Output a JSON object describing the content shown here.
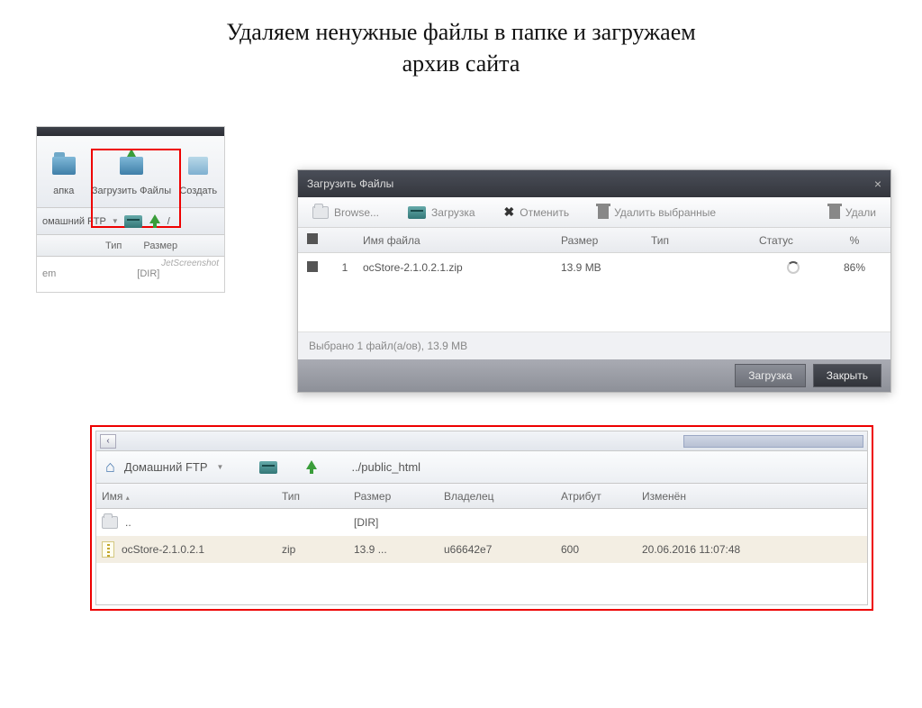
{
  "title_line1": "Удаляем ненужные файлы в папке и загружаем",
  "title_line2": "архив сайта",
  "panelA": {
    "btn_folder": "апка",
    "btn_upload": "Загрузить Файлы",
    "btn_create": "Создать",
    "path_label": "омашний FTP",
    "slash": "/",
    "head_type": "Тип",
    "head_size": "Размер",
    "watermark": "JetScreenshot",
    "dir": "[DIR]",
    "em": "em"
  },
  "panelB": {
    "dialog_title": "Загрузить Файлы",
    "browse": "Browse...",
    "upload": "Загрузка",
    "cancel": "Отменить",
    "delete_selected": "Удалить выбранные",
    "delete": "Удали",
    "col_name": "Имя файла",
    "col_size": "Размер",
    "col_type": "Тип",
    "col_status": "Статус",
    "col_pct": "%",
    "row_num": "1",
    "row_name": "ocStore-2.1.0.2.1.zip",
    "row_size": "13.9 MB",
    "row_pct": "86%",
    "footer_info": "Выбрано 1 файл(а/ов), 13.9 MB",
    "btn_upload": "Загрузка",
    "btn_close": "Закрыть"
  },
  "panelC": {
    "nav_home": "Домашний FTP",
    "nav_path": "../public_html",
    "col_name": "Имя",
    "col_type": "Тип",
    "col_size": "Размер",
    "col_owner": "Владелец",
    "col_attr": "Атрибут",
    "col_modified": "Изменён",
    "row1_name": "..",
    "row1_size": "[DIR]",
    "row2_name": "ocStore-2.1.0.2.1",
    "row2_type": "zip",
    "row2_size": "13.9 ...",
    "row2_owner": "u66642e7",
    "row2_attr": "600",
    "row2_modified": "20.06.2016 11:07:48"
  }
}
